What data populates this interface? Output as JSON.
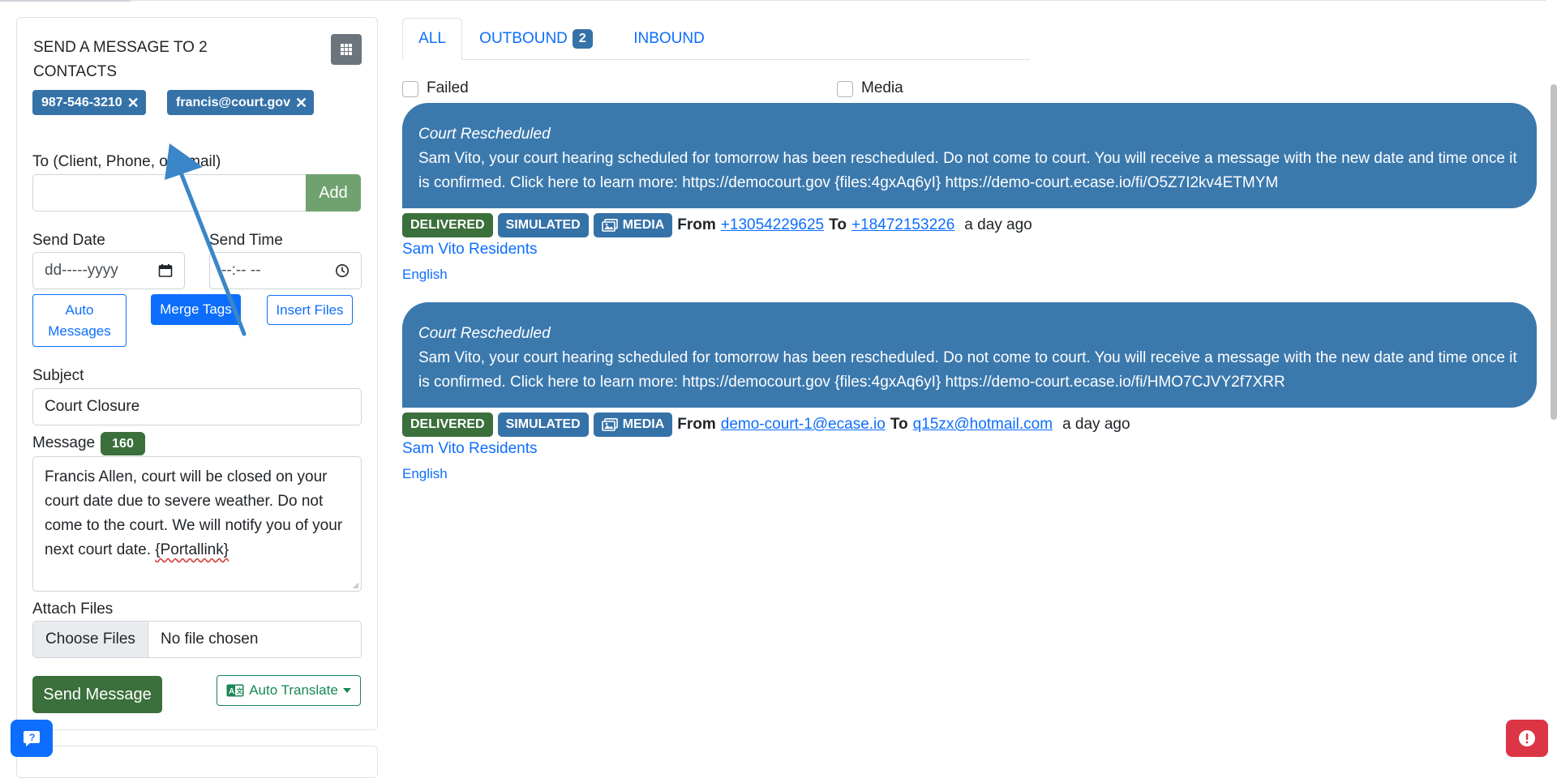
{
  "composer": {
    "title": "SEND A MESSAGE TO 2 CONTACTS",
    "recipients": [
      {
        "label": "987-546-3210",
        "remove": "✕"
      },
      {
        "label": "francis@court.gov",
        "remove": "✕"
      }
    ],
    "to_label": "To (Client, Phone, or Email)",
    "to_value": "",
    "add_label": "Add",
    "send_date_label": "Send Date",
    "send_date_placeholder": "dd-----yyyy",
    "send_time_label": "Send Time",
    "send_time_placeholder": "--:-- --",
    "auto_messages_label": "Auto Messages",
    "merge_tags_label": "Merge Tags",
    "insert_files_label": "Insert Files",
    "subject_label": "Subject",
    "subject_value": "Court Closure",
    "message_label": "Message",
    "message_count": "160",
    "message_text": "Francis Allen, court will be closed on your court date due to severe weather. Do not come to the court. We will notify you of your next court date. ",
    "message_link": "{Portallink}",
    "attach_label": "Attach Files",
    "choose_files_label": "Choose Files",
    "no_file_label": "No file chosen",
    "send_label": "Send Message",
    "translate_label": "Auto Translate"
  },
  "tabs": [
    {
      "label": "ALL",
      "active": true
    },
    {
      "label": "OUTBOUND",
      "badge": "2"
    },
    {
      "label": "INBOUND"
    }
  ],
  "filters": {
    "failed_label": "Failed",
    "media_label": "Media"
  },
  "messages": [
    {
      "subject": "Court Rescheduled",
      "body": "Sam Vito, your court hearing scheduled for tomorrow has been rescheduled. Do not come to court. You will receive a message with the new date and time once it is confirmed. Click here to learn more: https://democourt.gov {files:4gxAq6yI} https://demo-court.ecase.io/fi/O5Z7I2kv4ETMYM",
      "status": "DELIVERED",
      "mode": "SIMULATED",
      "media": "MEDIA",
      "from_label": "From",
      "from": "+13054229625",
      "to_label": "To",
      "to": "+18472153226",
      "time": "a day ago",
      "group": "Sam Vito Residents",
      "language": "English"
    },
    {
      "subject": "Court Rescheduled",
      "body": "Sam Vito, your court hearing scheduled for tomorrow has been rescheduled. Do not come to court. You will receive a message with the new date and time once it is confirmed. Click here to learn more: https://democourt.gov {files:4gxAq6yI} https://demo-court.ecase.io/fi/HMO7CJVY2f7XRR",
      "status": "DELIVERED",
      "mode": "SIMULATED",
      "media": "MEDIA",
      "from_label": "From",
      "from": "demo-court-1@ecase.io",
      "to_label": "To",
      "to": "q15zx@hotmail.com",
      "time": "a day ago",
      "group": "Sam Vito Residents",
      "language": "English"
    }
  ],
  "colors": {
    "primary": "#0d6efd",
    "bubble": "#3b79ad",
    "delivered": "#3b6f3b",
    "badge": "#3572a8",
    "danger": "#dc3545",
    "annotation_arrow": "#3a86c8"
  },
  "icons": {
    "grid": "grid-icon",
    "calendar": "calendar-icon",
    "clock": "clock-icon",
    "media": "images-icon",
    "translate": "translate-icon",
    "caret": "caret-down-icon",
    "help": "help-chat-icon",
    "alert": "alert-icon"
  }
}
